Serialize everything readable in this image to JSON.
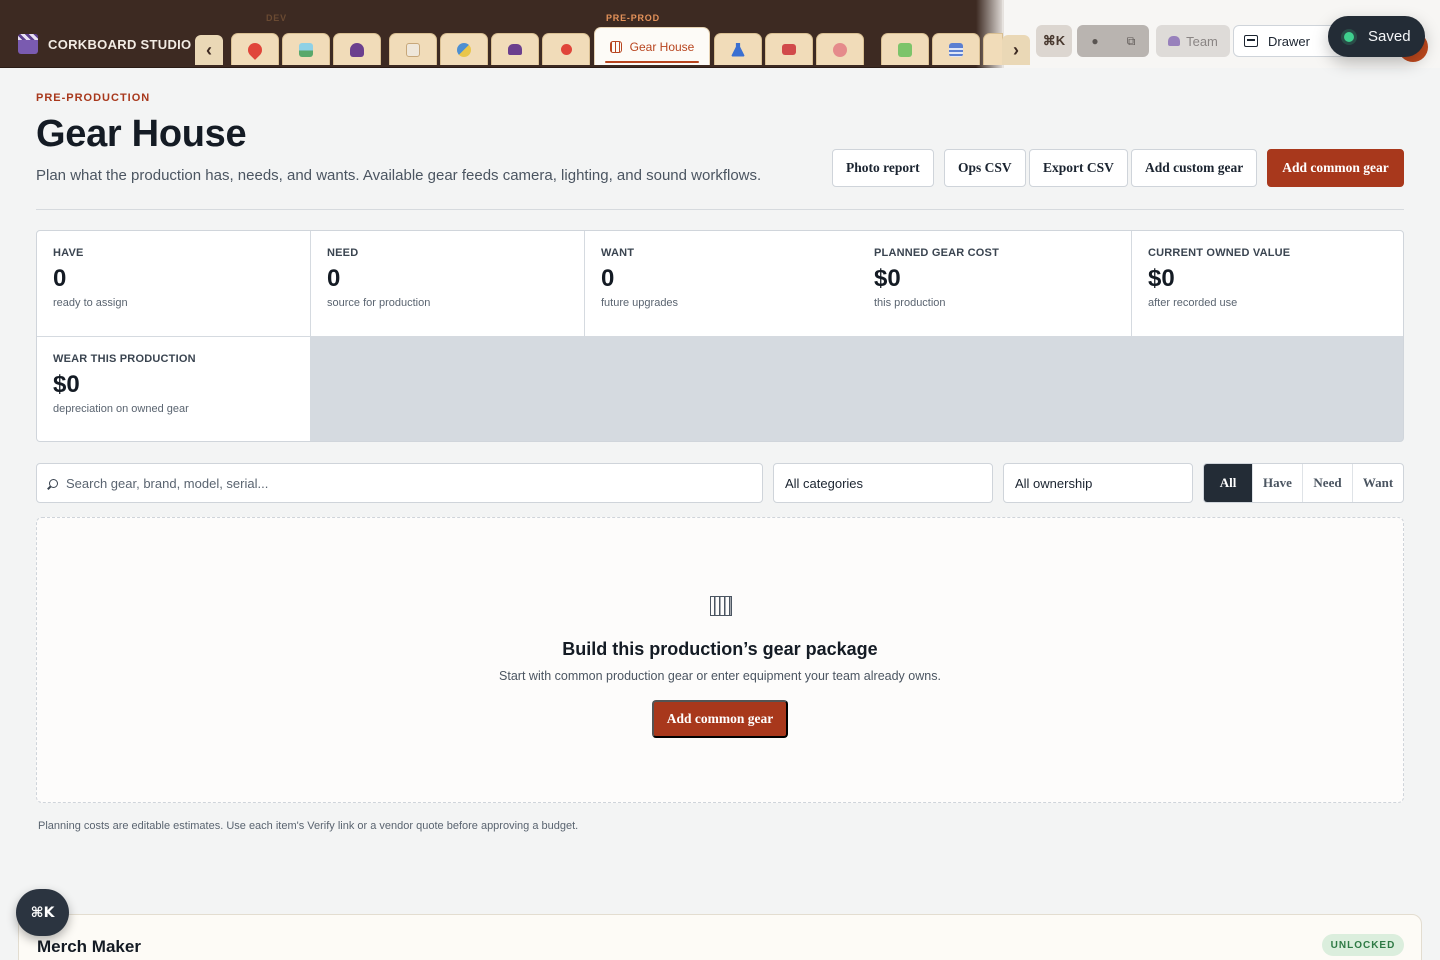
{
  "app": {
    "brand": "CORKBOARD STUDIO",
    "groups": {
      "dev": "DEV",
      "pre": "PRE-PROD"
    },
    "active_tab": "Gear House",
    "arrow_left": "‹",
    "arrow_right": "›",
    "tab_icons": [
      {
        "name": "pin-icon",
        "color": "#e0453a"
      },
      {
        "name": "image-icon",
        "color": "#59a86b"
      },
      {
        "name": "person-icon",
        "color": "#6b3f8e"
      },
      {
        "name": "clipboard-icon",
        "color": "#c7a77a"
      },
      {
        "name": "masks-icon",
        "color": "#4d8fd1"
      },
      {
        "name": "people-icon",
        "color": "#6b3f8e"
      },
      {
        "name": "map-pin-icon",
        "color": "#e0453a"
      },
      {
        "name": "dress-icon",
        "color": "#3a6fd1"
      },
      {
        "name": "toolbox-icon",
        "color": "#d14a4a"
      },
      {
        "name": "palette-icon",
        "color": "#e58b8b"
      },
      {
        "name": "puzzle-icon",
        "color": "#7cc46a"
      },
      {
        "name": "calendar-icon",
        "color": "#5b7fd1"
      }
    ],
    "toolbar": {
      "cmd": "⌘K",
      "team": "Team",
      "drawer": "Drawer"
    },
    "toast": "Saved",
    "colors": {
      "accent": "#a8381c",
      "dark": "#3d2a22"
    }
  },
  "header": {
    "eyebrow": "PRE-PRODUCTION",
    "title": "Gear House",
    "subtitle": "Plan what the production has, needs, and wants. Available gear feeds camera, lighting, and sound workflows.",
    "buttons": {
      "photo_report": "Photo report",
      "ops_csv": "Ops CSV",
      "export_csv": "Export CSV",
      "add_custom": "Add custom gear",
      "add_common": "Add common gear"
    }
  },
  "stats": {
    "have": {
      "label": "HAVE",
      "value": "0",
      "note": "ready to assign"
    },
    "need": {
      "label": "NEED",
      "value": "0",
      "note": "source for production"
    },
    "want": {
      "label": "WANT",
      "value": "0",
      "note": "future upgrades"
    },
    "planned": {
      "label": "PLANNED GEAR COST",
      "value": "$0",
      "note": "this production"
    },
    "owned": {
      "label": "CURRENT OWNED VALUE",
      "value": "$0",
      "note": "after recorded use"
    },
    "wear": {
      "label": "WEAR THIS PRODUCTION",
      "value": "$0",
      "note": "depreciation on owned gear"
    }
  },
  "filters": {
    "search_placeholder": "Search gear, brand, model, serial...",
    "category": "All categories",
    "ownership": "All ownership",
    "segments": {
      "all": "All",
      "have": "Have",
      "need": "Need",
      "want": "Want"
    }
  },
  "empty": {
    "title": "Build this production’s gear package",
    "subtitle": "Start with common production gear or enter equipment your team already owns.",
    "button": "Add common gear"
  },
  "footnote": "Planning costs are editable estimates. Use each item's Verify link or a vendor quote before approving a budget.",
  "merch": {
    "title": "Merch Maker",
    "badge": "UNLOCKED"
  },
  "fab": "⌘K"
}
